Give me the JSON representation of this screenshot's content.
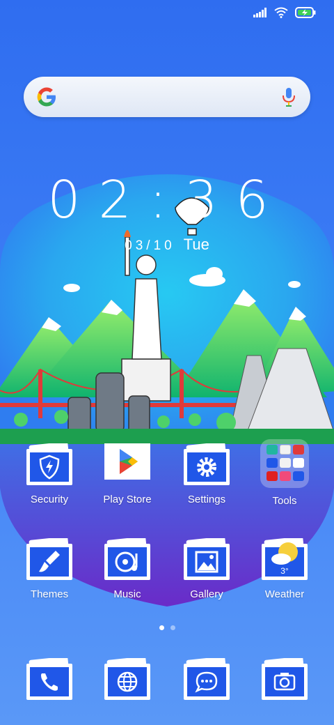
{
  "status_bar": {
    "icons": [
      "signal-icon",
      "wifi-icon",
      "battery-charging-icon"
    ]
  },
  "search": {
    "logo": "google-logo-icon",
    "mic": "mic-icon"
  },
  "clock": {
    "time": "02:36",
    "date": "03/10",
    "weekday": "Tue"
  },
  "apps_row1": [
    {
      "label": "Security",
      "icon": "shield-bolt-icon"
    },
    {
      "label": "Play Store",
      "icon": "play-store-icon"
    },
    {
      "label": "Settings",
      "icon": "gear-icon"
    },
    {
      "label": "Tools",
      "icon": "folder-icon"
    }
  ],
  "apps_row2": [
    {
      "label": "Themes",
      "icon": "paintbrush-icon"
    },
    {
      "label": "Music",
      "icon": "music-disc-icon"
    },
    {
      "label": "Gallery",
      "icon": "image-icon"
    },
    {
      "label": "Weather",
      "icon": "weather-sun-cloud-icon",
      "temp": "3°"
    }
  ],
  "dock": [
    {
      "icon": "phone-icon"
    },
    {
      "icon": "globe-icon"
    },
    {
      "icon": "message-icon"
    },
    {
      "icon": "camera-icon"
    }
  ],
  "page_indicator": {
    "count": 2,
    "active": 0
  },
  "colors": {
    "accent": "#3d7ef5",
    "tile": "#1f57e8"
  }
}
